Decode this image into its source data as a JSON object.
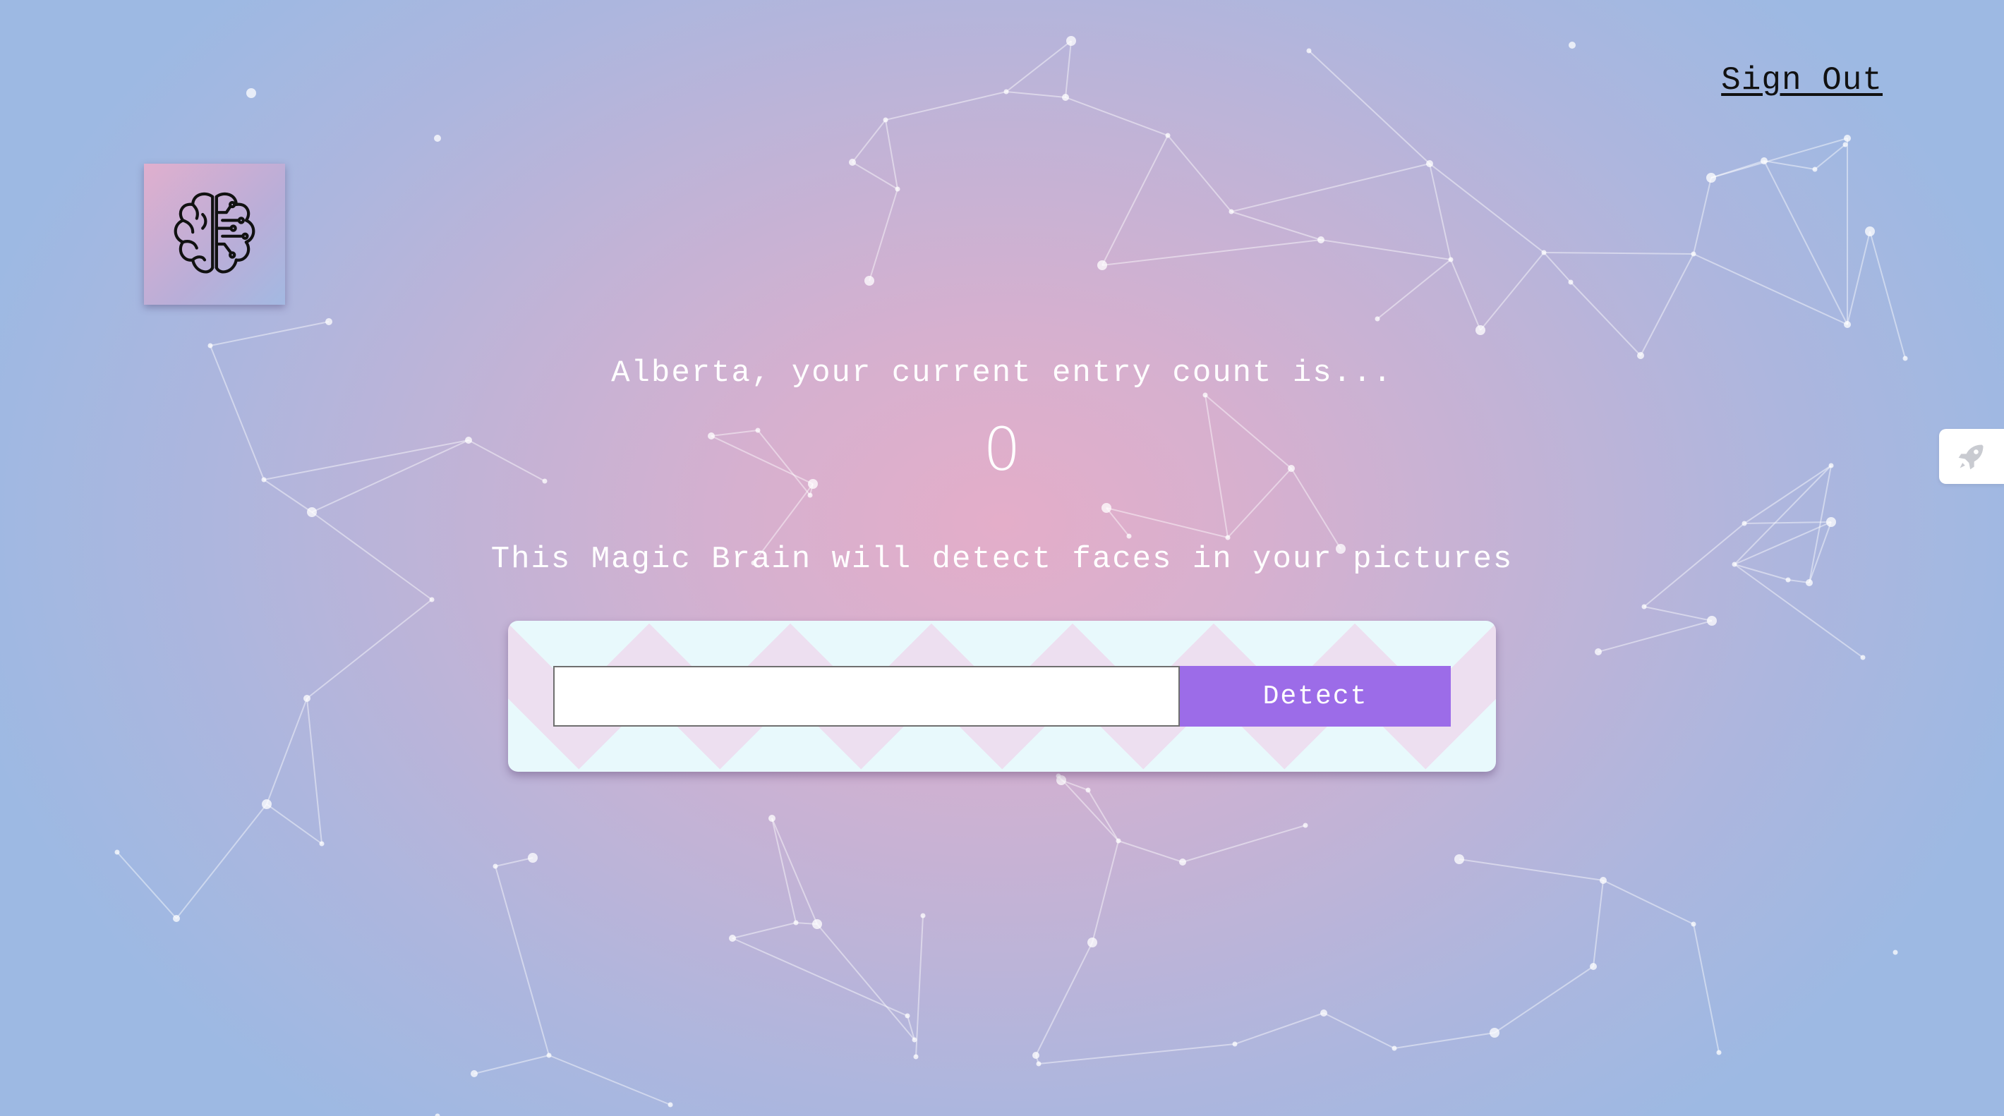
{
  "nav": {
    "sign_out_label": "Sign Out"
  },
  "logo": {
    "icon": "brain-icon"
  },
  "side_tab": {
    "icon": "rocket-icon"
  },
  "rank": {
    "greeting": "Alberta, your current entry count is...",
    "entry_count": "0"
  },
  "main": {
    "tagline": "This Magic Brain will detect faces in your pictures"
  },
  "form": {
    "image_url_value": "",
    "detect_label": "Detect"
  },
  "colors": {
    "accent_button": "#9c6ce8",
    "background_center": "#e4aec9",
    "background_edge": "#9db9e3",
    "text": "#ffffff"
  }
}
